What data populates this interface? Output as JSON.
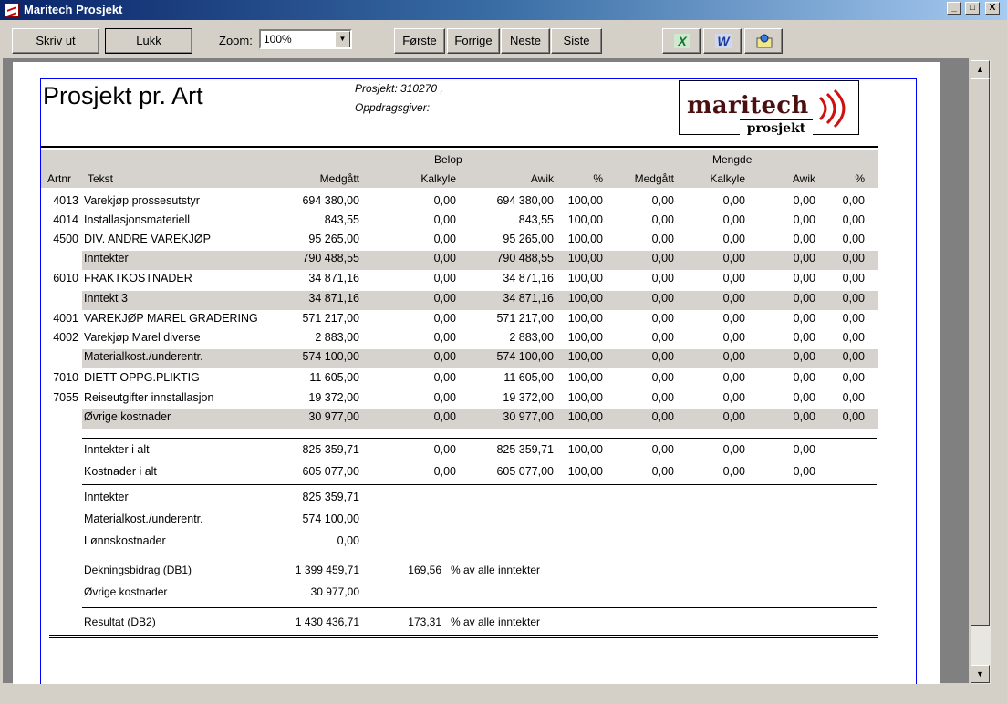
{
  "window": {
    "title": "Maritech Prosjekt",
    "min": "_",
    "max": "□",
    "close": "X"
  },
  "toolbar": {
    "print": "Skriv ut",
    "close": "Lukk",
    "zoom_label": "Zoom:",
    "zoom_value": "100%",
    "first": "Første",
    "prev": "Forrige",
    "next": "Neste",
    "last": "Siste",
    "excel_icon": "X",
    "word_icon": "W"
  },
  "report": {
    "title": "Prosjekt pr. Art",
    "project": "Prosjekt: 310270 ,",
    "client": "Oppdragsgiver:",
    "logo_main": "maritech",
    "logo_sub": "prosjekt",
    "group_belop": "Belop",
    "group_mengde": "Mengde",
    "col_artnr": "Artnr",
    "col_tekst": "Tekst",
    "col_medgatt": "Medgått",
    "col_kalkyle": "Kalkyle",
    "col_awik": "Awik",
    "col_pct": "%",
    "col_medgatt2": "Medgått",
    "col_kalkyle2": "Kalkyle",
    "col_awik2": "Awik",
    "col_pct2": "%",
    "rows": [
      [
        "4013",
        "Varekjøp prossesutstyr",
        "694 380,00",
        "0,00",
        "694 380,00",
        "100,00",
        "0,00",
        "0,00",
        "0,00",
        "0,00"
      ],
      [
        "4014",
        "Installasjonsmateriell",
        "843,55",
        "0,00",
        "843,55",
        "100,00",
        "0,00",
        "0,00",
        "0,00",
        "0,00"
      ],
      [
        "4500",
        "DIV. ANDRE VAREKJØP",
        "95 265,00",
        "0,00",
        "95 265,00",
        "100,00",
        "0,00",
        "0,00",
        "0,00",
        "0,00"
      ],
      [
        "",
        "Inntekter",
        "790 488,55",
        "0,00",
        "790 488,55",
        "100,00",
        "0,00",
        "0,00",
        "0,00",
        "0,00"
      ],
      [
        "6010",
        "FRAKTKOSTNADER",
        "34 871,16",
        "0,00",
        "34 871,16",
        "100,00",
        "0,00",
        "0,00",
        "0,00",
        "0,00"
      ],
      [
        "",
        "Inntekt 3",
        "34 871,16",
        "0,00",
        "34 871,16",
        "100,00",
        "0,00",
        "0,00",
        "0,00",
        "0,00"
      ],
      [
        "4001",
        "VAREKJØP MAREL GRADERING",
        "571 217,00",
        "0,00",
        "571 217,00",
        "100,00",
        "0,00",
        "0,00",
        "0,00",
        "0,00"
      ],
      [
        "4002",
        "Varekjøp Marel diverse",
        "2 883,00",
        "0,00",
        "2 883,00",
        "100,00",
        "0,00",
        "0,00",
        "0,00",
        "0,00"
      ],
      [
        "",
        "Materialkost./underentr.",
        "574 100,00",
        "0,00",
        "574 100,00",
        "100,00",
        "0,00",
        "0,00",
        "0,00",
        "0,00"
      ],
      [
        "7010",
        "DIETT OPPG.PLIKTIG",
        "11 605,00",
        "0,00",
        "11 605,00",
        "100,00",
        "0,00",
        "0,00",
        "0,00",
        "0,00"
      ],
      [
        "7055",
        "Reiseutgifter innstallasjon",
        "19 372,00",
        "0,00",
        "19 372,00",
        "100,00",
        "0,00",
        "0,00",
        "0,00",
        "0,00"
      ],
      [
        "",
        "Øvrige kostnader",
        "30 977,00",
        "0,00",
        "30 977,00",
        "100,00",
        "0,00",
        "0,00",
        "0,00",
        "0,00"
      ]
    ],
    "totals": [
      [
        "Inntekter i alt",
        "825 359,71",
        "0,00",
        "825 359,71",
        "100,00",
        "0,00",
        "0,00",
        "0,00"
      ],
      [
        "Kostnader i alt",
        "605 077,00",
        "0,00",
        "605 077,00",
        "100,00",
        "0,00",
        "0,00",
        "0,00"
      ]
    ],
    "summary": [
      [
        "Inntekter",
        "825 359,71"
      ],
      [
        "Materialkost./underentr.",
        "574 100,00"
      ],
      [
        "Lønnskostnader",
        "0,00"
      ]
    ],
    "db1": {
      "label": "Dekningsbidrag (DB1)",
      "value": "1 399 459,71",
      "pct": "169,56",
      "note": "% av alle inntekter"
    },
    "ovrige": {
      "label": "Øvrige kostnader",
      "value": "30 977,00"
    },
    "db2": {
      "label": "Resultat (DB2)",
      "value": "1 430 436,71",
      "pct": "173,31",
      "note": "% av alle inntekter"
    }
  }
}
